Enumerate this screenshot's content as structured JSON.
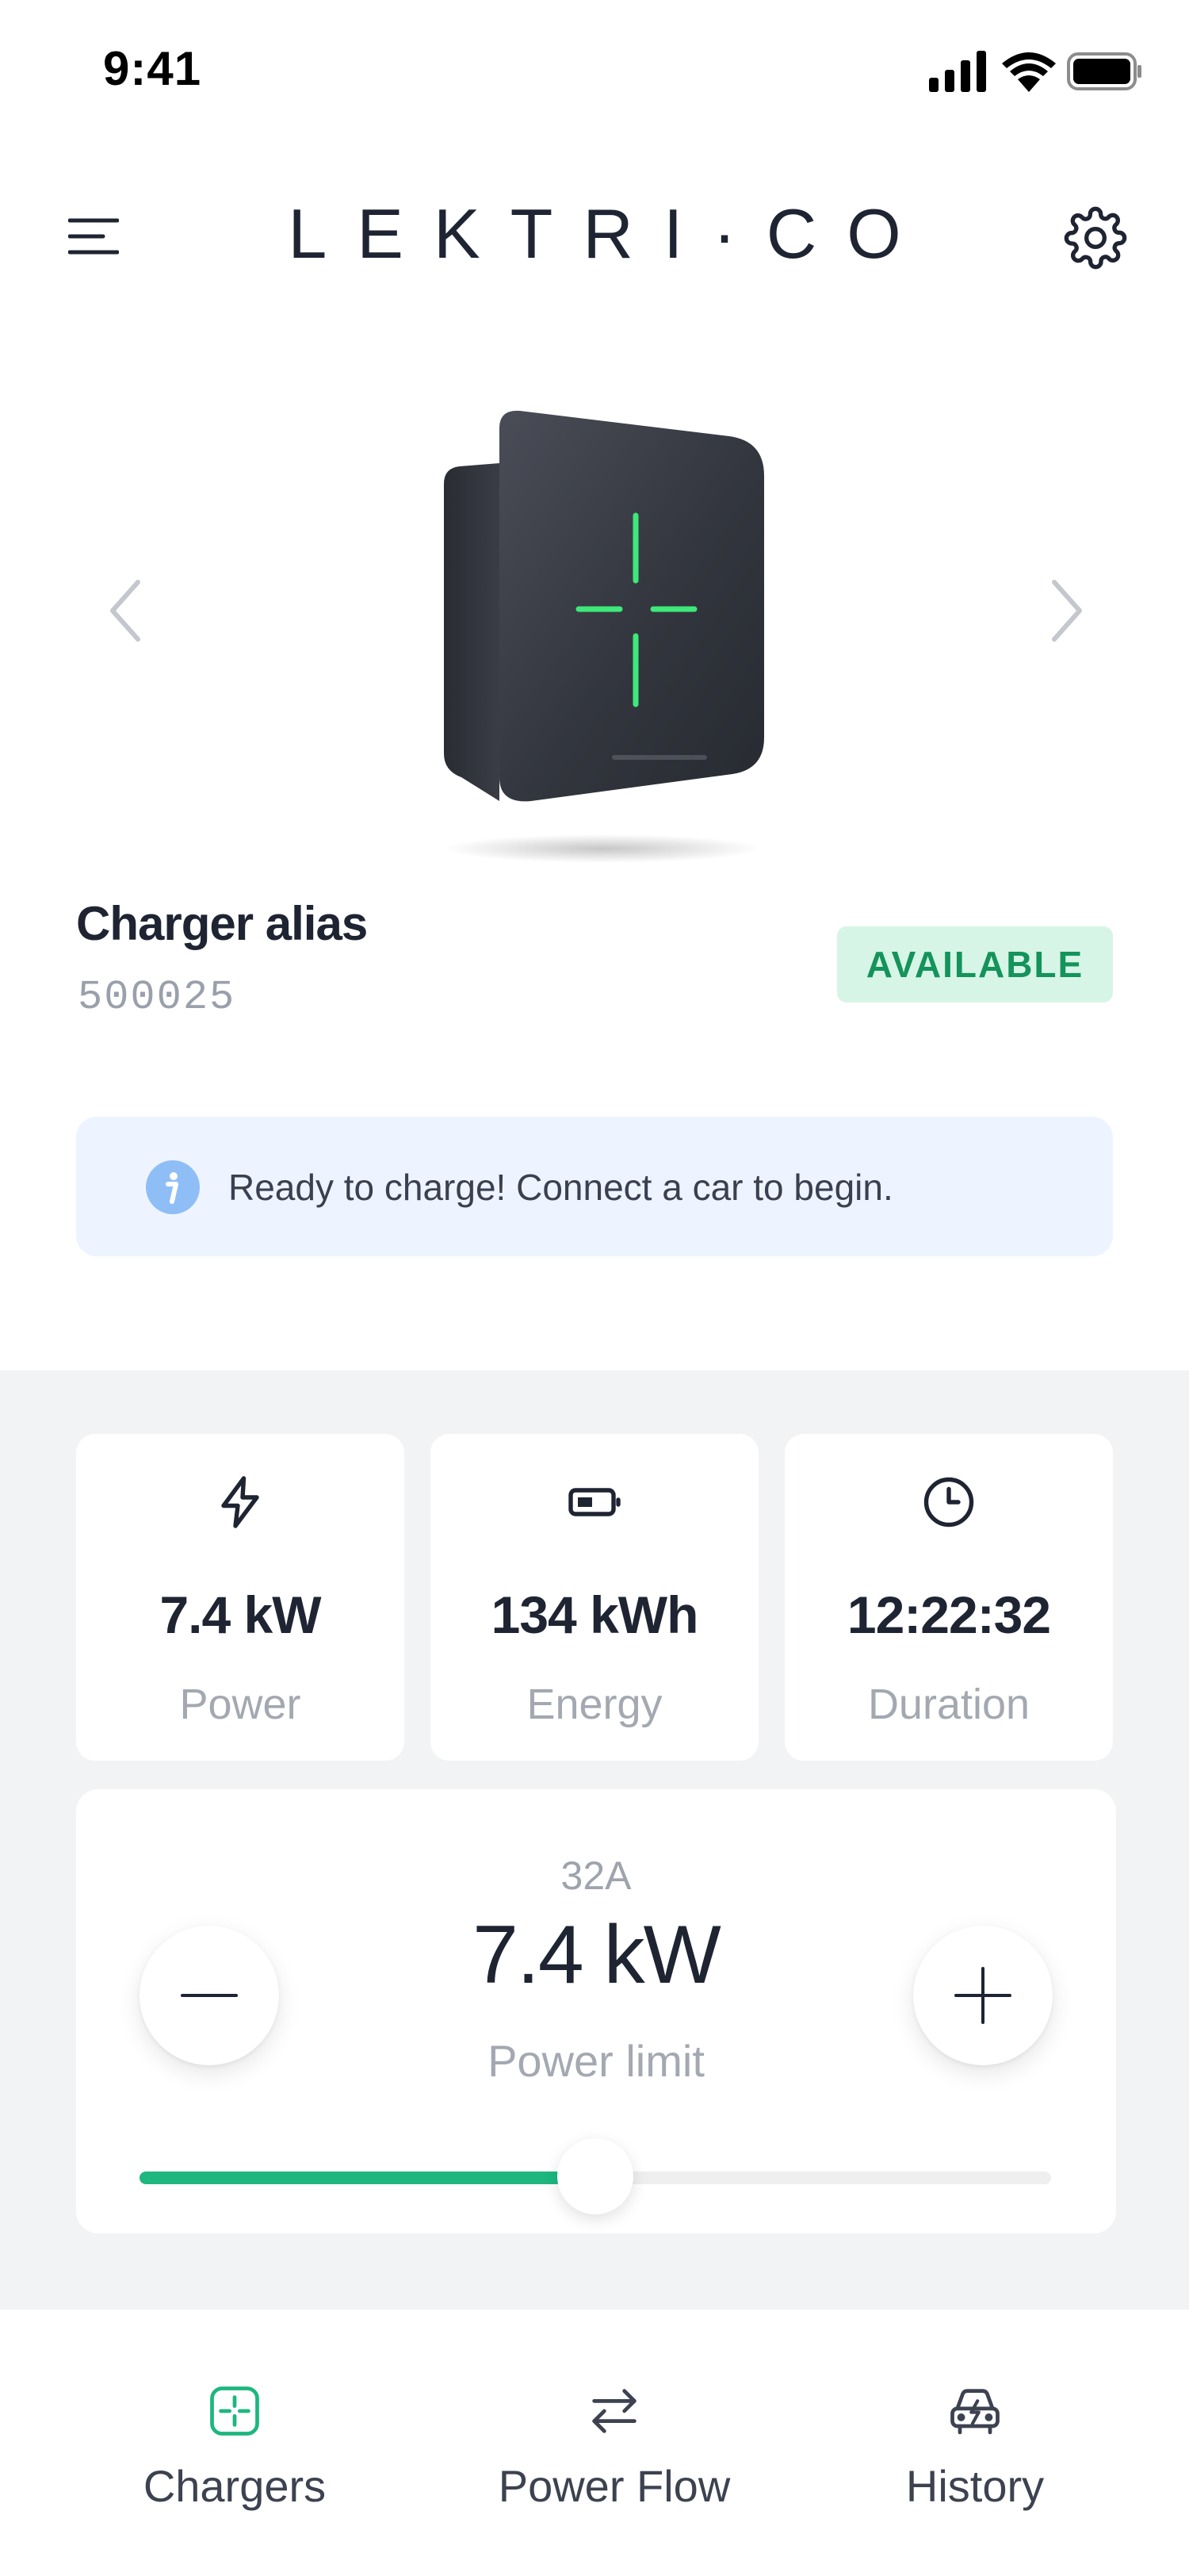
{
  "status_bar": {
    "time": "9:41"
  },
  "header": {
    "brand": "LEKTRI·CO"
  },
  "charger": {
    "alias": "Charger alias",
    "serial": "500025",
    "status": "AVAILABLE"
  },
  "info_banner": {
    "message": "Ready to charge! Connect a car to begin."
  },
  "stats": [
    {
      "icon": "lightning-icon",
      "value": "7.4 kW",
      "label": "Power"
    },
    {
      "icon": "battery-icon",
      "value": "134 kWh",
      "label": "Energy"
    },
    {
      "icon": "clock-icon",
      "value": "12:22:32",
      "label": "Duration"
    }
  ],
  "power_limit": {
    "current": "32A",
    "value": "7.4 kW",
    "label": "Power limit",
    "slider_fraction": 0.5
  },
  "bottom_nav": [
    {
      "icon": "charger-icon",
      "label": "Chargers",
      "active": true
    },
    {
      "icon": "power-flow-icon",
      "label": "Power Flow",
      "active": false
    },
    {
      "icon": "car-history-icon",
      "label": "History",
      "active": false
    }
  ],
  "colors": {
    "accent": "#1db77f",
    "available_bg": "#d7f5e6",
    "available_text": "#14935a",
    "info_bg": "#eef4ff",
    "info_icon": "#8fbef7",
    "led_green": "#3ee87a"
  }
}
